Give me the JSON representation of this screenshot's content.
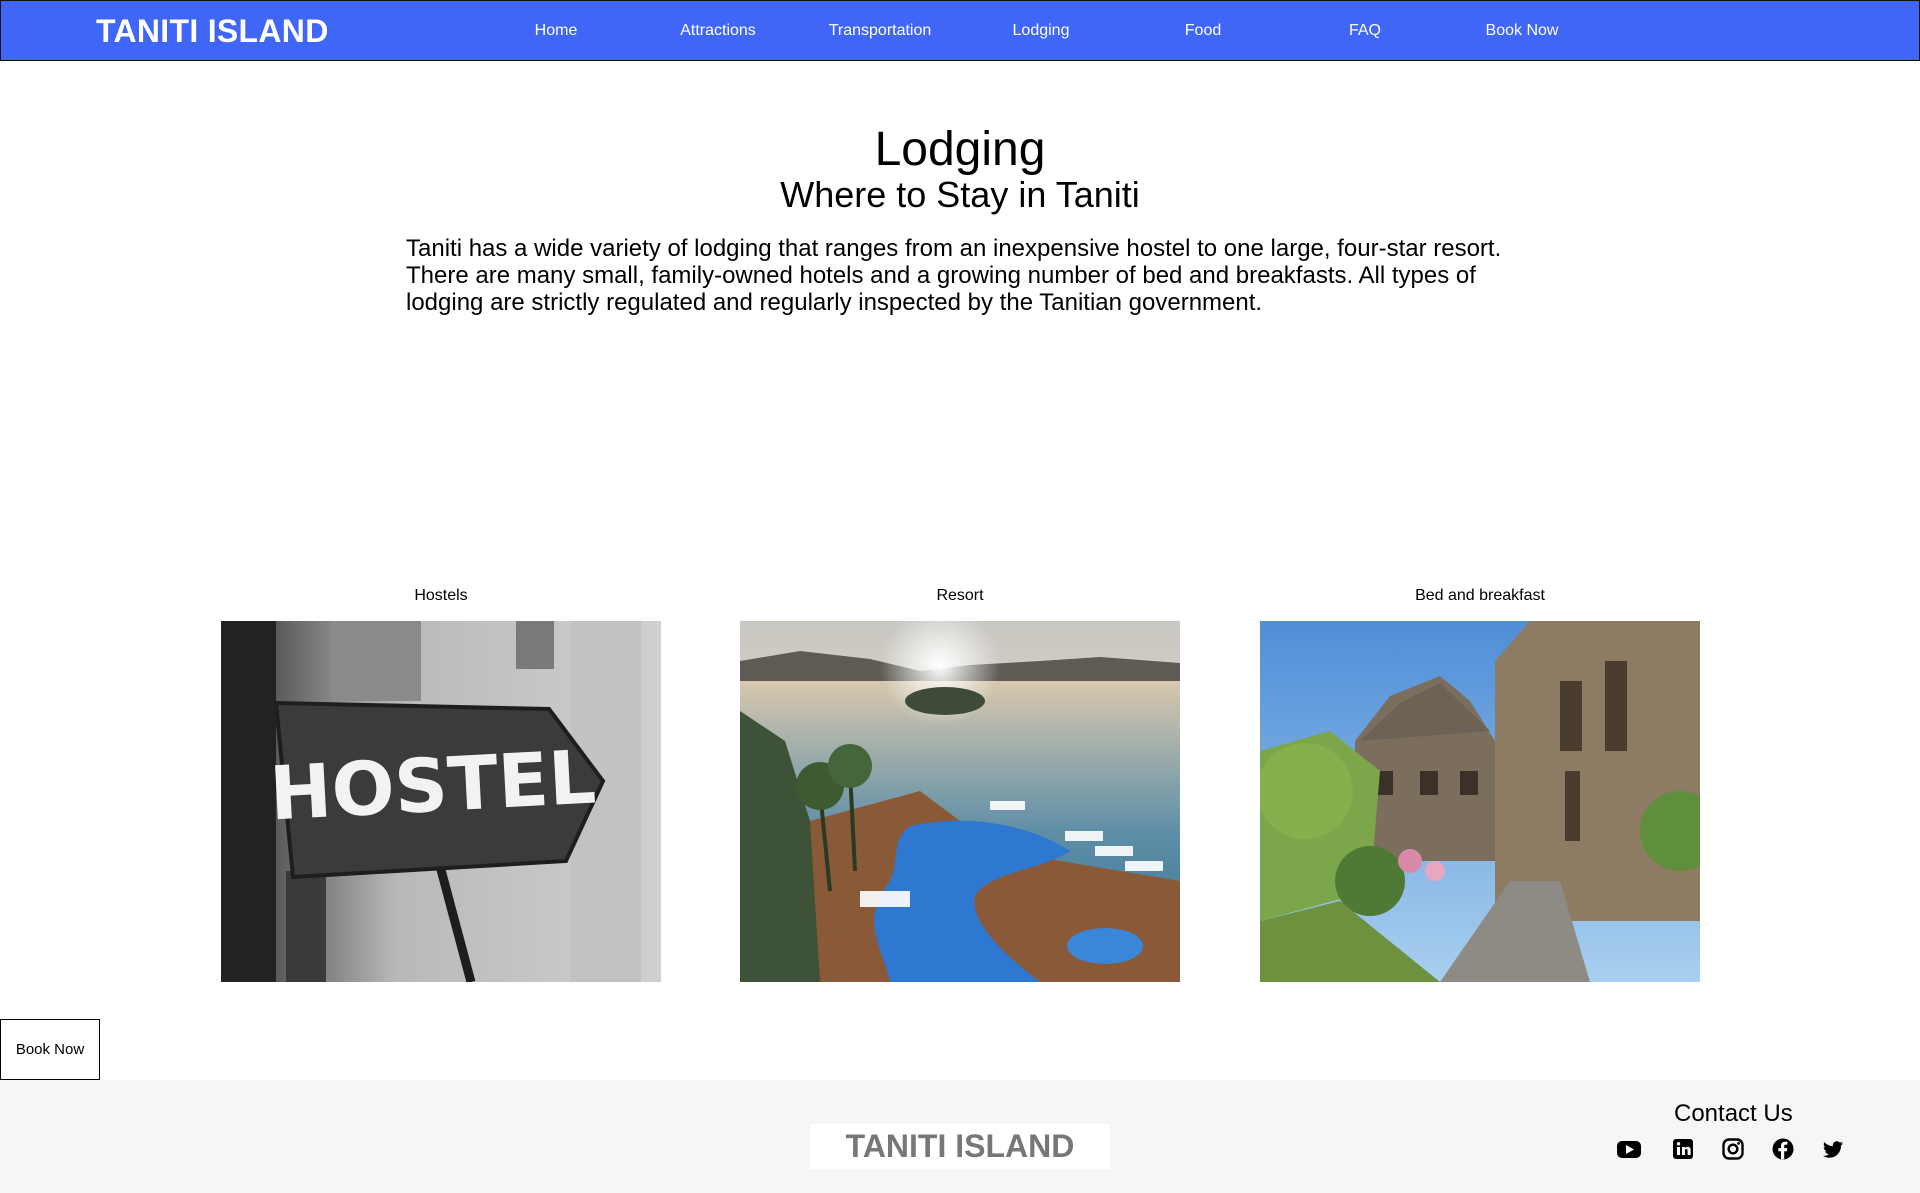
{
  "header": {
    "brand": "TANITI ISLAND",
    "nav": [
      {
        "label": "Home"
      },
      {
        "label": "Attractions"
      },
      {
        "label": "Transportation"
      },
      {
        "label": "Lodging"
      },
      {
        "label": "Food"
      },
      {
        "label": "FAQ"
      },
      {
        "label": "Book Now"
      }
    ]
  },
  "main": {
    "title": "Lodging",
    "subtitle": "Where to Stay in Taniti",
    "intro": "Taniti has a wide variety of lodging that ranges from an inexpensive hostel to one large, four-star resort. There are many small, family-owned hotels and a growing number of bed and breakfasts. All types of lodging are strictly regulated and regularly inspected by the Tanitian government.",
    "cards": [
      {
        "caption": "Hostels",
        "sign_text": "HOSTEL",
        "image_icon": "hostel-sign-photo"
      },
      {
        "caption": "Resort",
        "image_icon": "resort-pool-photo"
      },
      {
        "caption": "Bed and breakfast",
        "image_icon": "stone-cottage-photo"
      }
    ]
  },
  "book_button": {
    "label": "Book Now"
  },
  "footer": {
    "brand": "TANITI ISLAND",
    "contact_title": "Contact Us",
    "social": [
      "youtube-icon",
      "linkedin-icon",
      "instagram-icon",
      "facebook-icon",
      "twitter-icon"
    ]
  },
  "colors": {
    "header_bg": "#3f66f7",
    "footer_bg": "#f5f6f8",
    "footer_brand": "#777777"
  }
}
